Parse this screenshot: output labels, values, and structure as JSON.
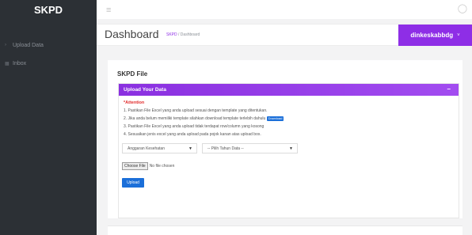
{
  "sidebar": {
    "brand": "SKPD",
    "items": [
      {
        "label": "Upload Data",
        "icon": "upload-icon"
      },
      {
        "label": "Inbox",
        "icon": "inbox-icon"
      }
    ]
  },
  "topbar": {
    "hamburger_icon": "menu-icon",
    "bell_icon": "bell-icon"
  },
  "header": {
    "title": "Dashboard",
    "breadcrumb_home": "SKPD",
    "breadcrumb_separator": "/",
    "breadcrumb_current": "Dashboard",
    "user": "dinkeskabbdg",
    "user_chevron": "˅"
  },
  "content": {
    "title": "SKPD File",
    "panel_title": "Upload Your Data",
    "panel_toggle": "–",
    "attention": "*Attention",
    "rules": [
      "1. Pastikan File Excel yang anda upload sesuai dengan template yang ditentukan.",
      "2. Jika anda belum memiliki template silahkan download template terlebih dahulu",
      "3. Pastikan File Excel yang anda upload tidak terdapat row/column yang kosong",
      "4. Sesuaikan jenis excel yang anda upload pada pojok kanan atas upload box."
    ],
    "download_label": "Download",
    "select_jenis": "Anggaran Kesehatan",
    "select_tahun": "-- Pilih Tahun Data --",
    "choose_file_label": "Choose File",
    "no_file_label": "No file chosen",
    "upload_label": "Upload"
  },
  "colors": {
    "accent": "#8e2ee6",
    "sidebar_bg": "#2c3035",
    "button_blue": "#1b6fd9",
    "attention_red": "#e22d2d"
  }
}
